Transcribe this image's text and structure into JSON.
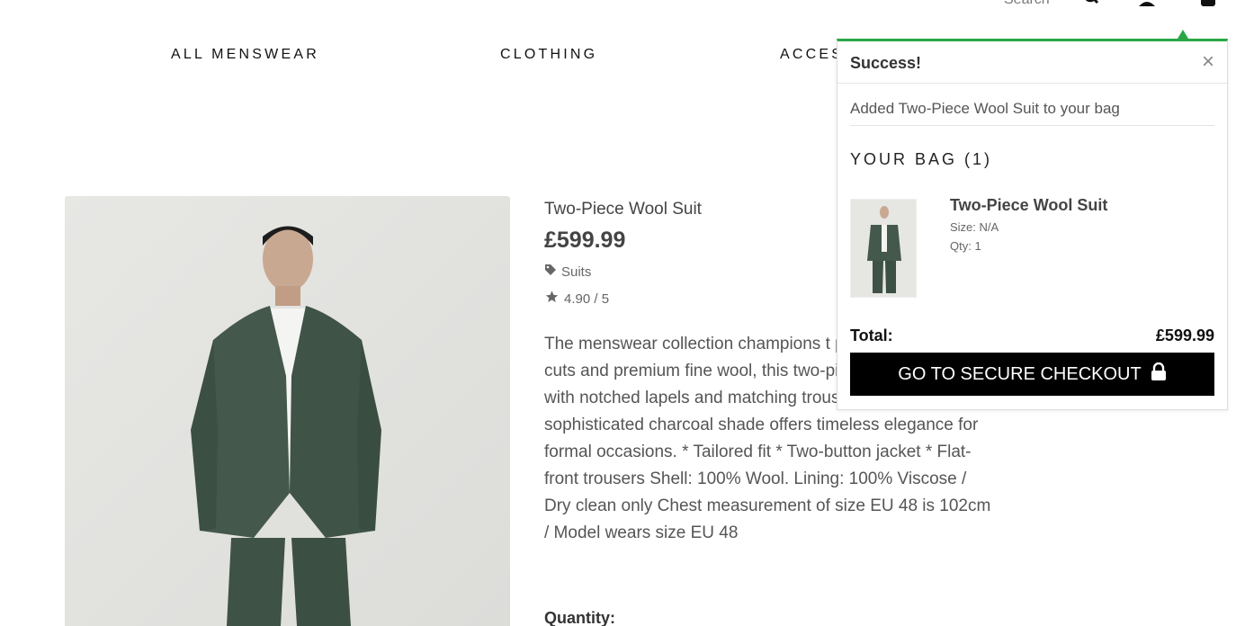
{
  "header": {
    "search_label": "Search",
    "icons": [
      "search-icon",
      "account-icon",
      "bag-icon"
    ]
  },
  "nav": {
    "items": [
      {
        "label": "ALL MENSWEAR"
      },
      {
        "label": "CLOTHING"
      },
      {
        "label": "ACCES"
      }
    ]
  },
  "product": {
    "title": "Two-Piece Wool Suit",
    "price": "£599.99",
    "category": "Suits",
    "rating": "4.90 / 5",
    "description": "The menswear collection champions t pillars of perfected cuts and premium fine wool, this two-piece suit features with notched lapels and matching trousers. The sophisticated charcoal shade offers timeless elegance for formal occasions. * Tailored fit * Two-button jacket * Flat-front trousers Shell: 100% Wool. Lining: 100% Viscose / Dry clean only Chest measurement of size EU 48 is 102cm / Model wears size EU 48",
    "quantity_label": "Quantity:"
  },
  "popup": {
    "title": "Success!",
    "close": "×",
    "message": "Added Two-Piece Wool Suit to your bag",
    "bag_heading": "YOUR BAG (1)",
    "item": {
      "name": "Two-Piece Wool Suit",
      "size": "Size: N/A",
      "qty": "Qty: 1"
    },
    "total_label": "Total:",
    "total_value": "£599.99",
    "checkout_label": "GO TO SECURE CHECKOUT",
    "accent_color": "#28a745"
  }
}
